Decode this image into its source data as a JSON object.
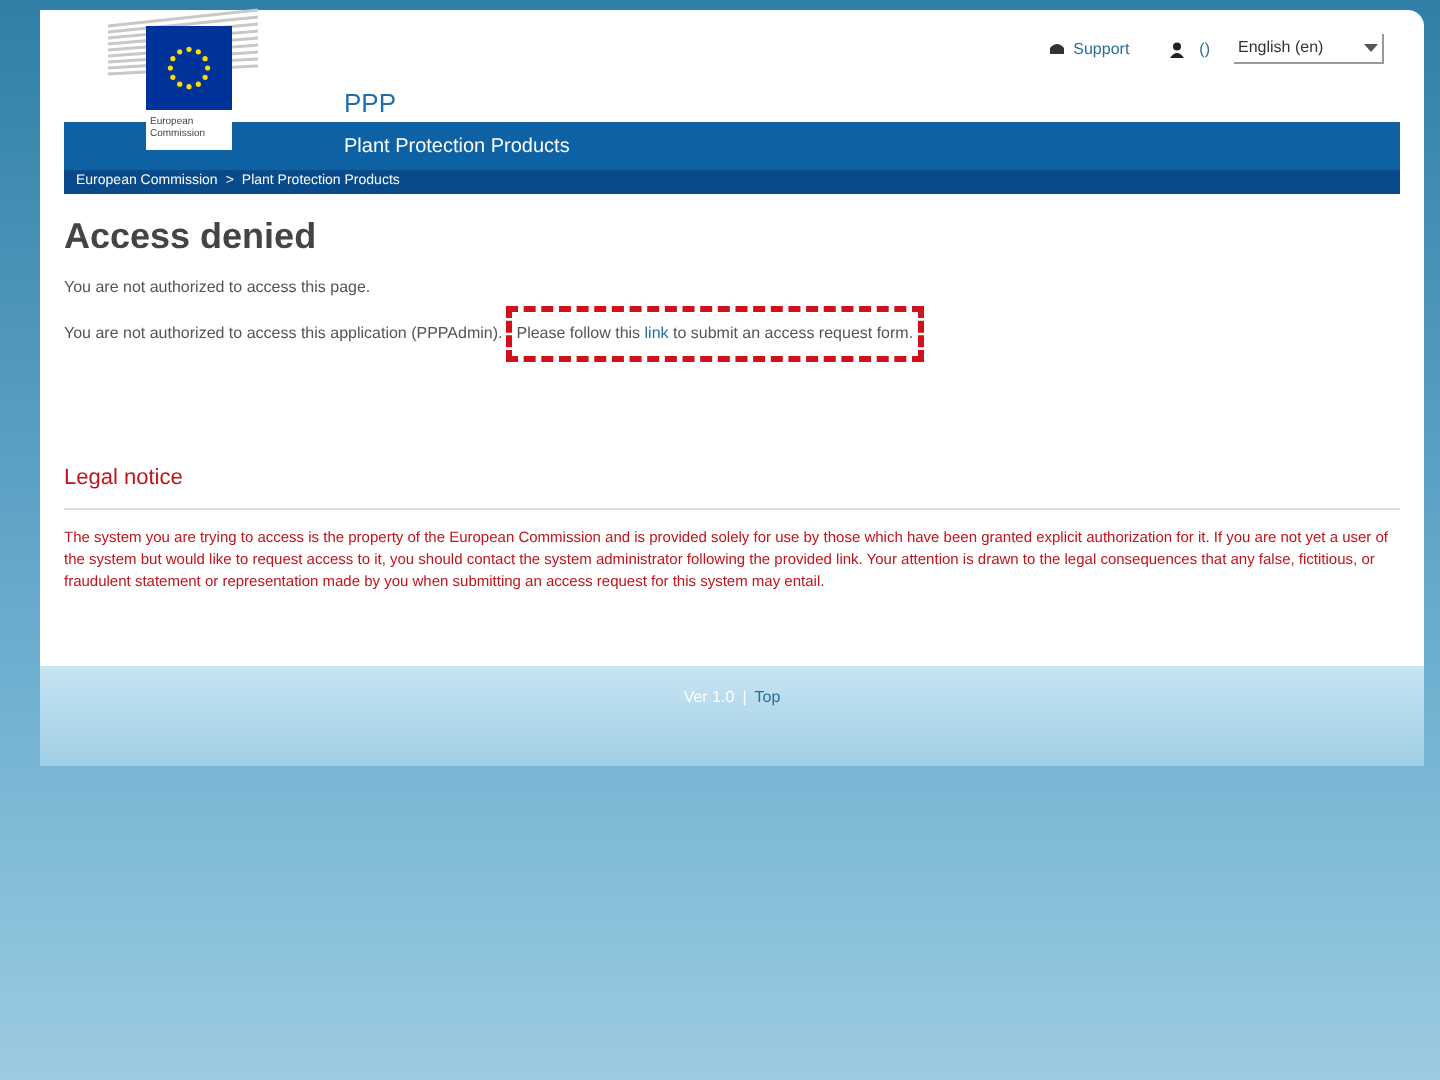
{
  "top_links": {
    "support": "Support",
    "user": "()",
    "language": {
      "value": "English (en)"
    }
  },
  "logo": {
    "line1": "European",
    "line2": "Commission"
  },
  "site": {
    "acronym": "PPP",
    "title": "Plant Protection Products"
  },
  "breadcrumb": [
    "European Commission",
    "Plant Protection Products"
  ],
  "breadcrumb_separator": ">",
  "heading": "Access denied",
  "messages": [
    "You are not authorized to access this page."
  ],
  "request": {
    "before": "You are not authorized to access this application (PPPAdmin).",
    "instruction_before": "Please follow this ",
    "link": "link",
    "instruction_after": " to submit an access request form."
  },
  "legal": {
    "title": "Legal notice",
    "text": "The system you are trying to access is the property of the European Commission and is provided solely for use by those which have been granted explicit authorization for it. If you are not yet a user of the system but would like to request access to it, you should contact the system administrator following the provided link. Your attention is drawn to the legal consequences that any false, fictitious, or fraudulent statement or representation made by you when submitting an access request for this system may entail."
  },
  "footer": {
    "version": "Ver 1.0",
    "separator": "|",
    "link": "Top"
  }
}
